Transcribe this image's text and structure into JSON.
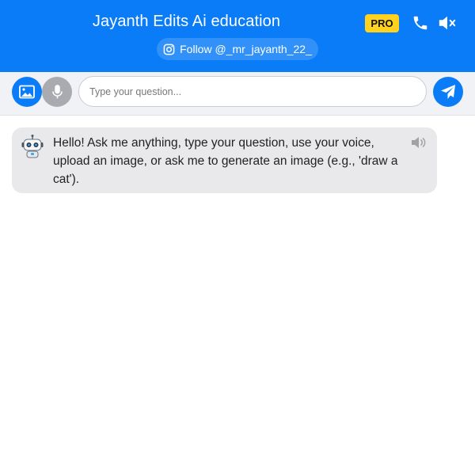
{
  "header": {
    "title": "Jayanth Edits Ai education",
    "pro_badge": "PRO",
    "follow_text": "Follow @_mr_jayanth_22_",
    "icons": [
      "instagram-icon",
      "phone-icon",
      "volume-mute-icon"
    ]
  },
  "input_bar": {
    "placeholder": "Type your question...",
    "icons": [
      "image-icon",
      "microphone-icon",
      "send-icon"
    ]
  },
  "messages": [
    {
      "sender": "bot",
      "text": "Hello! Ask me anything, type your question, use your voice, upload an image, or ask me to generate an image (e.g., 'draw a cat').",
      "icons": [
        "robot-avatar-icon",
        "speaker-icon"
      ]
    }
  ],
  "colors": {
    "accent": "#0a7cf7",
    "pro_badge": "#ffd21f",
    "mic_button": "#a9abb0",
    "bubble": "#e9e9eb"
  }
}
